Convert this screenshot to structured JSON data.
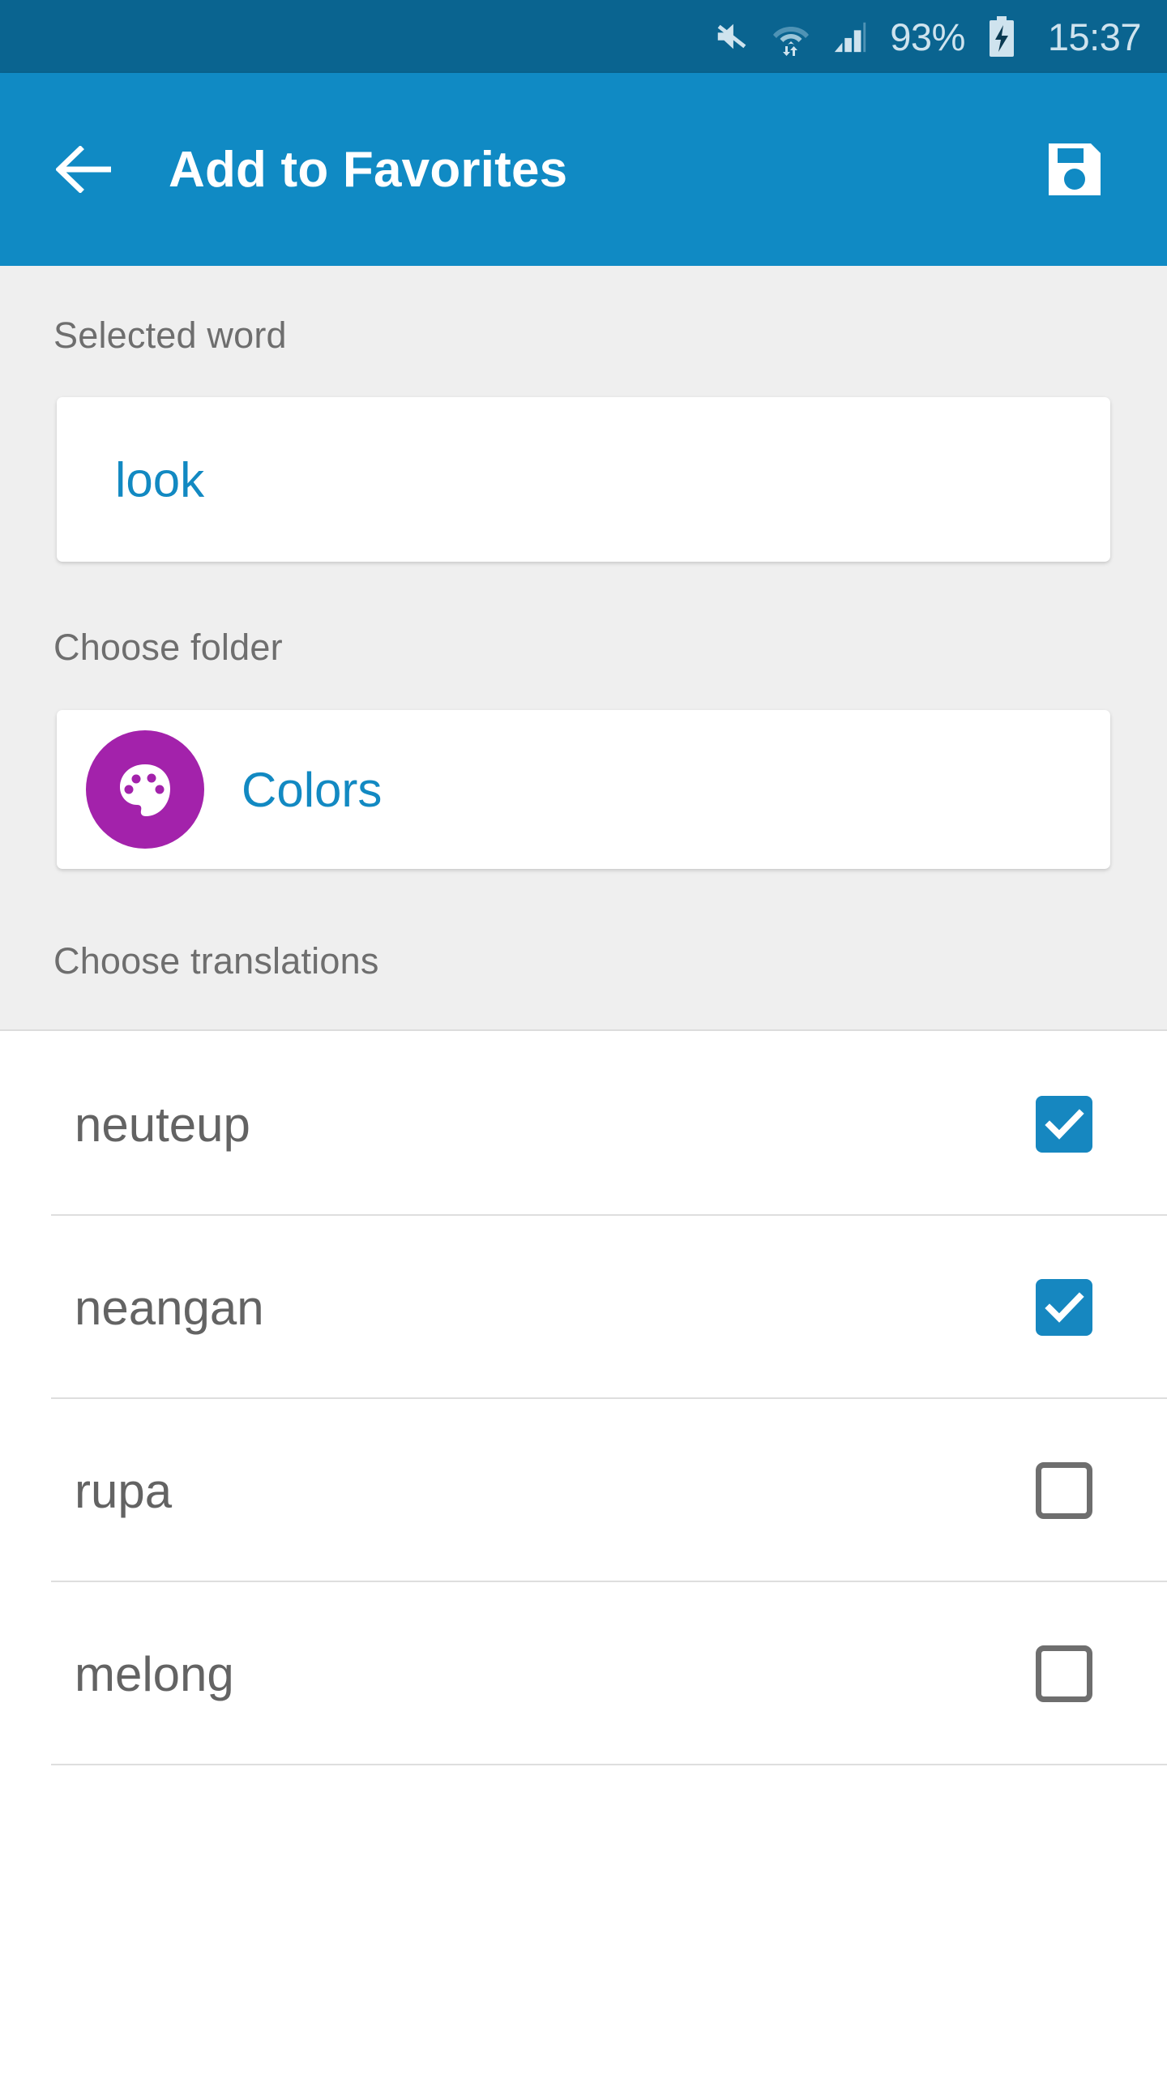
{
  "status_bar": {
    "battery_percent": "93%",
    "clock": "15:37",
    "icons": [
      "mute-icon",
      "wifi-icon",
      "signal-icon",
      "battery-charging-icon"
    ],
    "background_color": "#0a6490",
    "text_color": "#cfe3ee"
  },
  "app_bar": {
    "title": "Add to Favorites",
    "back_icon": "back-arrow-icon",
    "save_icon": "save-floppy-icon",
    "background_color": "#108ac4",
    "title_color": "#ffffff"
  },
  "form": {
    "selected_word": {
      "label": "Selected word",
      "value": "look",
      "value_color": "#1289c2"
    },
    "choose_folder": {
      "label": "Choose folder",
      "folder_name": "Colors",
      "folder_icon": "palette-icon",
      "avatar_color": "#a322ab",
      "name_color": "#1289c2"
    },
    "choose_translations": {
      "label": "Choose translations"
    },
    "background_color": "#efefef",
    "label_color": "#6e6e6e"
  },
  "translations": {
    "items": [
      {
        "label": "neuteup",
        "checked": true
      },
      {
        "label": "neangan",
        "checked": true
      },
      {
        "label": "rupa",
        "checked": false
      },
      {
        "label": "melong",
        "checked": false
      }
    ],
    "checked_color": "#1687c0",
    "unchecked_border_color": "#6e6e6e",
    "label_color": "#636363"
  }
}
